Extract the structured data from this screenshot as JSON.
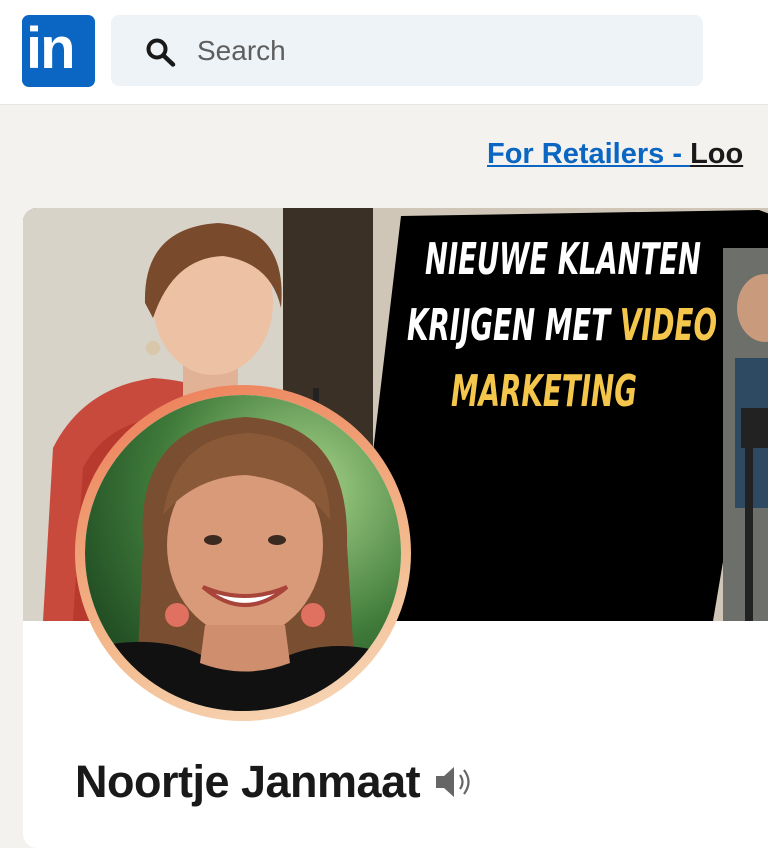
{
  "nav": {
    "logo_text": "in",
    "search_placeholder": "Search"
  },
  "promo": {
    "link_text": "For Retailers - ",
    "rest_text": "Loo"
  },
  "banner": {
    "line1": "NIEUWE KLANTEN",
    "line2a": "KRIJGEN MET ",
    "line2b": "VIDEO",
    "line3": "MARKETING",
    "accent_color": "#f4c64b",
    "text_color": "#ffffff"
  },
  "profile": {
    "name": "Noortje Janmaat"
  }
}
